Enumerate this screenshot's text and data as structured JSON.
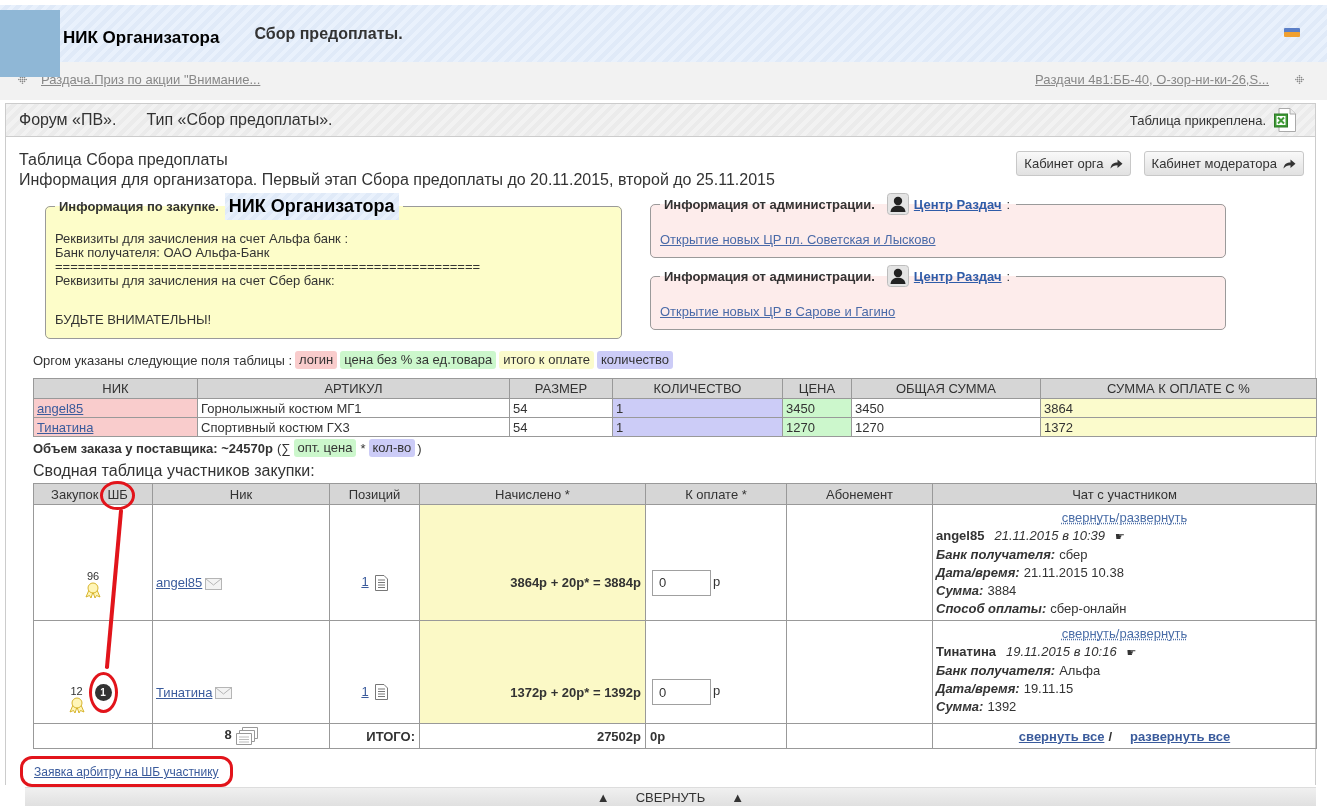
{
  "header": {
    "organizer": "НИК Организатора",
    "title": "Сбор предоплаты."
  },
  "nav": {
    "left_link": "Раздача.Приз по акции \"Внимание...",
    "right_link": "Раздачи 4в1:ББ-40, О-зор-ни-ки-26,S..."
  },
  "forum_bar": {
    "forum": "Форум «ПВ».",
    "type": "Тип «Сбор предоплаты».",
    "attachment": "Таблица прикреплена."
  },
  "intro": {
    "title": "Таблица Сбора предоплаты",
    "info": "Информация для организатора. Первый этап Сбора предоплаты до 20.11.2015, второй до 25.11.2015"
  },
  "buttons": [
    "Кабинет орга",
    "Кабинет модератора"
  ],
  "purchase_info": {
    "legend": "Информация по закупке.",
    "organizer": "НИК Организатора",
    "blocks": [
      [
        "Реквизиты для зачисления на счет Альфа банк :",
        "Банк получателя: ОАО Альфа-Банк",
        "========================================================",
        "Реквизиты для зачисления на счет Сбер банк:"
      ],
      [
        "БУДЬТЕ ВНИМАТЕЛЬНЫ!"
      ]
    ]
  },
  "admin_notices": [
    {
      "legend": "Информация от администрации.",
      "author": "Центр Раздач",
      "separator": ":",
      "link": "Открытие новых ЦР пл. Советская и Лысково"
    },
    {
      "legend": "Информация от администрации.",
      "author": "Центр Раздач",
      "separator": ":",
      "link": "Открытие новых ЦР в Сарове и Гагино"
    }
  ],
  "field_legend": {
    "label": "Оргом указаны следующие поля таблицы :",
    "tags": [
      {
        "text": "логин",
        "color": "#f9cccc"
      },
      {
        "text": "цена без % за ед.товара",
        "color": "#ccf7cc"
      },
      {
        "text": "итого к оплате",
        "color": "#fbfbcc"
      },
      {
        "text": "количество",
        "color": "#ccccf7"
      }
    ]
  },
  "items_table": {
    "columns": [
      {
        "label": "НИК",
        "color": "#f9cccc"
      },
      {
        "label": "АРТИКУЛ"
      },
      {
        "label": "РАЗМЕР"
      },
      {
        "label": "КОЛИЧЕСТВО",
        "color": "#ccccf7"
      },
      {
        "label": "ЦЕНА",
        "color": "#ccf7cc"
      },
      {
        "label": "ОБЩАЯ СУММА"
      },
      {
        "label": "СУММА К ОПЛАТЕ С %",
        "color": "#fbfbcc"
      }
    ],
    "rows": [
      [
        "angel85",
        "Горнолыжный костюм МГ1",
        "54",
        "1",
        "3450",
        "3450",
        "3864"
      ],
      [
        "Тинатина",
        "Спортивный костюм ГХ3",
        "54",
        "1",
        "1270",
        "1270",
        "1372"
      ]
    ]
  },
  "volume": {
    "label": "Объем заказа у поставщика: ~24570р",
    "open": "(∑",
    "tags": [
      {
        "text": "опт. цена",
        "color": "#ccf7cc"
      },
      {
        "text": "кол-во",
        "color": "#ccccf7"
      }
    ],
    "operator": "*",
    "close": ")"
  },
  "summary": {
    "title": "Сводная таблица участников закупки:",
    "columns": [
      {
        "label": "Закупок",
        "mark": "ШБ",
        "circled": true
      },
      {
        "label": "Ник"
      },
      {
        "label": "Позиций"
      },
      {
        "label": "Начислено *",
        "color": "#fbf9c6"
      },
      {
        "label": "К оплате *"
      },
      {
        "label": "Абонемент"
      },
      {
        "label": "Чат с участником"
      }
    ],
    "rows": [
      {
        "rating": "96",
        "nick": "angel85",
        "positions": "1",
        "accrued": "3864р + 20р* = 3884р",
        "to_pay": "0",
        "currency": "р",
        "chat": {
          "toggle": "свернуть/развернуть",
          "author": "angel85",
          "time": "21.11.2015 в 10:39",
          "pointer": "☛",
          "fields": [
            {
              "label": "Банк получателя:",
              "value": "сбер"
            },
            {
              "label": "Дата/время:",
              "value": "21.11.2015 10.38"
            },
            {
              "label": "Сумма:",
              "value": "3884"
            },
            {
              "label": "Способ оплаты:",
              "value": "сбер-онлайн"
            }
          ]
        }
      },
      {
        "rating": "12",
        "badge": {
          "text": "1",
          "circled": true
        },
        "nick": "Тинатина",
        "positions": "1",
        "accrued": "1372р + 20р* = 1392р",
        "to_pay": "0",
        "currency": "р",
        "chat": {
          "toggle": "свернуть/развернуть",
          "author": "Тинатина",
          "time": "19.11.2015 в 10:16",
          "pointer": "☛",
          "fields": [
            {
              "label": "Банк получателя:",
              "value": "Альфа"
            },
            {
              "label": "Дата/время:",
              "value": "19.11.15"
            },
            {
              "label": "Сумма:",
              "value": "1392"
            }
          ]
        }
      }
    ],
    "footer": {
      "positions": "8",
      "total_label": "ИТОГО:",
      "accrued": "27502р",
      "to_pay": "0р",
      "collapse_all": "свернуть все",
      "divider": "/",
      "expand_all": "развернуть все"
    }
  },
  "arbiter_link": {
    "text": "Заявка арбитру на ШБ участнику",
    "circled": true
  },
  "collapse_bar": {
    "left_arrow": "▲",
    "label": "СВЕРНУТЬ",
    "right_arrow": "▲"
  }
}
